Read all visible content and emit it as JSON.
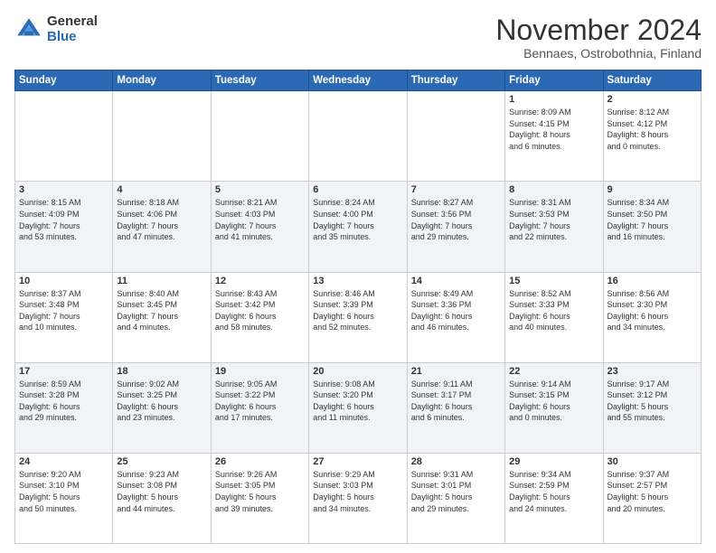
{
  "header": {
    "logo_general": "General",
    "logo_blue": "Blue",
    "month_title": "November 2024",
    "subtitle": "Bennaes, Ostrobothnia, Finland"
  },
  "days_of_week": [
    "Sunday",
    "Monday",
    "Tuesday",
    "Wednesday",
    "Thursday",
    "Friday",
    "Saturday"
  ],
  "weeks": [
    [
      {
        "day": "",
        "info": ""
      },
      {
        "day": "",
        "info": ""
      },
      {
        "day": "",
        "info": ""
      },
      {
        "day": "",
        "info": ""
      },
      {
        "day": "",
        "info": ""
      },
      {
        "day": "1",
        "info": "Sunrise: 8:09 AM\nSunset: 4:15 PM\nDaylight: 8 hours\nand 6 minutes."
      },
      {
        "day": "2",
        "info": "Sunrise: 8:12 AM\nSunset: 4:12 PM\nDaylight: 8 hours\nand 0 minutes."
      }
    ],
    [
      {
        "day": "3",
        "info": "Sunrise: 8:15 AM\nSunset: 4:09 PM\nDaylight: 7 hours\nand 53 minutes."
      },
      {
        "day": "4",
        "info": "Sunrise: 8:18 AM\nSunset: 4:06 PM\nDaylight: 7 hours\nand 47 minutes."
      },
      {
        "day": "5",
        "info": "Sunrise: 8:21 AM\nSunset: 4:03 PM\nDaylight: 7 hours\nand 41 minutes."
      },
      {
        "day": "6",
        "info": "Sunrise: 8:24 AM\nSunset: 4:00 PM\nDaylight: 7 hours\nand 35 minutes."
      },
      {
        "day": "7",
        "info": "Sunrise: 8:27 AM\nSunset: 3:56 PM\nDaylight: 7 hours\nand 29 minutes."
      },
      {
        "day": "8",
        "info": "Sunrise: 8:31 AM\nSunset: 3:53 PM\nDaylight: 7 hours\nand 22 minutes."
      },
      {
        "day": "9",
        "info": "Sunrise: 8:34 AM\nSunset: 3:50 PM\nDaylight: 7 hours\nand 16 minutes."
      }
    ],
    [
      {
        "day": "10",
        "info": "Sunrise: 8:37 AM\nSunset: 3:48 PM\nDaylight: 7 hours\nand 10 minutes."
      },
      {
        "day": "11",
        "info": "Sunrise: 8:40 AM\nSunset: 3:45 PM\nDaylight: 7 hours\nand 4 minutes."
      },
      {
        "day": "12",
        "info": "Sunrise: 8:43 AM\nSunset: 3:42 PM\nDaylight: 6 hours\nand 58 minutes."
      },
      {
        "day": "13",
        "info": "Sunrise: 8:46 AM\nSunset: 3:39 PM\nDaylight: 6 hours\nand 52 minutes."
      },
      {
        "day": "14",
        "info": "Sunrise: 8:49 AM\nSunset: 3:36 PM\nDaylight: 6 hours\nand 46 minutes."
      },
      {
        "day": "15",
        "info": "Sunrise: 8:52 AM\nSunset: 3:33 PM\nDaylight: 6 hours\nand 40 minutes."
      },
      {
        "day": "16",
        "info": "Sunrise: 8:56 AM\nSunset: 3:30 PM\nDaylight: 6 hours\nand 34 minutes."
      }
    ],
    [
      {
        "day": "17",
        "info": "Sunrise: 8:59 AM\nSunset: 3:28 PM\nDaylight: 6 hours\nand 29 minutes."
      },
      {
        "day": "18",
        "info": "Sunrise: 9:02 AM\nSunset: 3:25 PM\nDaylight: 6 hours\nand 23 minutes."
      },
      {
        "day": "19",
        "info": "Sunrise: 9:05 AM\nSunset: 3:22 PM\nDaylight: 6 hours\nand 17 minutes."
      },
      {
        "day": "20",
        "info": "Sunrise: 9:08 AM\nSunset: 3:20 PM\nDaylight: 6 hours\nand 11 minutes."
      },
      {
        "day": "21",
        "info": "Sunrise: 9:11 AM\nSunset: 3:17 PM\nDaylight: 6 hours\nand 6 minutes."
      },
      {
        "day": "22",
        "info": "Sunrise: 9:14 AM\nSunset: 3:15 PM\nDaylight: 6 hours\nand 0 minutes."
      },
      {
        "day": "23",
        "info": "Sunrise: 9:17 AM\nSunset: 3:12 PM\nDaylight: 5 hours\nand 55 minutes."
      }
    ],
    [
      {
        "day": "24",
        "info": "Sunrise: 9:20 AM\nSunset: 3:10 PM\nDaylight: 5 hours\nand 50 minutes."
      },
      {
        "day": "25",
        "info": "Sunrise: 9:23 AM\nSunset: 3:08 PM\nDaylight: 5 hours\nand 44 minutes."
      },
      {
        "day": "26",
        "info": "Sunrise: 9:26 AM\nSunset: 3:05 PM\nDaylight: 5 hours\nand 39 minutes."
      },
      {
        "day": "27",
        "info": "Sunrise: 9:29 AM\nSunset: 3:03 PM\nDaylight: 5 hours\nand 34 minutes."
      },
      {
        "day": "28",
        "info": "Sunrise: 9:31 AM\nSunset: 3:01 PM\nDaylight: 5 hours\nand 29 minutes."
      },
      {
        "day": "29",
        "info": "Sunrise: 9:34 AM\nSunset: 2:59 PM\nDaylight: 5 hours\nand 24 minutes."
      },
      {
        "day": "30",
        "info": "Sunrise: 9:37 AM\nSunset: 2:57 PM\nDaylight: 5 hours\nand 20 minutes."
      }
    ]
  ]
}
